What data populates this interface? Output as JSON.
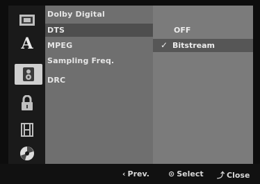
{
  "sidebar": {
    "icons": [
      {
        "name": "disc-menu-icon",
        "glyph": "▣"
      },
      {
        "name": "language-icon",
        "glyph": "A"
      },
      {
        "name": "audio-speaker-icon",
        "glyph": "🔊"
      },
      {
        "name": "lock-icon",
        "glyph": "🔒"
      },
      {
        "name": "film-icon",
        "glyph": "🎞"
      },
      {
        "name": "disc-icon",
        "glyph": "💿"
      }
    ]
  },
  "menu": {
    "items": [
      {
        "label": "Dolby Digital"
      },
      {
        "label": "DTS"
      },
      {
        "label": "MPEG"
      },
      {
        "label": "Sampling Freq."
      },
      {
        "label": "DRC"
      }
    ]
  },
  "options": {
    "items": [
      {
        "label": "OFF",
        "checked": false
      },
      {
        "label": "Bitstream",
        "checked": true
      }
    ],
    "check_glyph": "✓"
  },
  "footer": {
    "prev_icon": "‹",
    "prev_label": "Prev.",
    "select_icon": "⊙",
    "select_label": "Select",
    "close_icon": "⤴",
    "close_label": "Close"
  },
  "colors": {
    "menu_bg": "#6f6f6f",
    "options_bg": "#7b7b7b",
    "highlight": "#4e4e4e",
    "sidebar_bg": "#1a1a1a"
  }
}
